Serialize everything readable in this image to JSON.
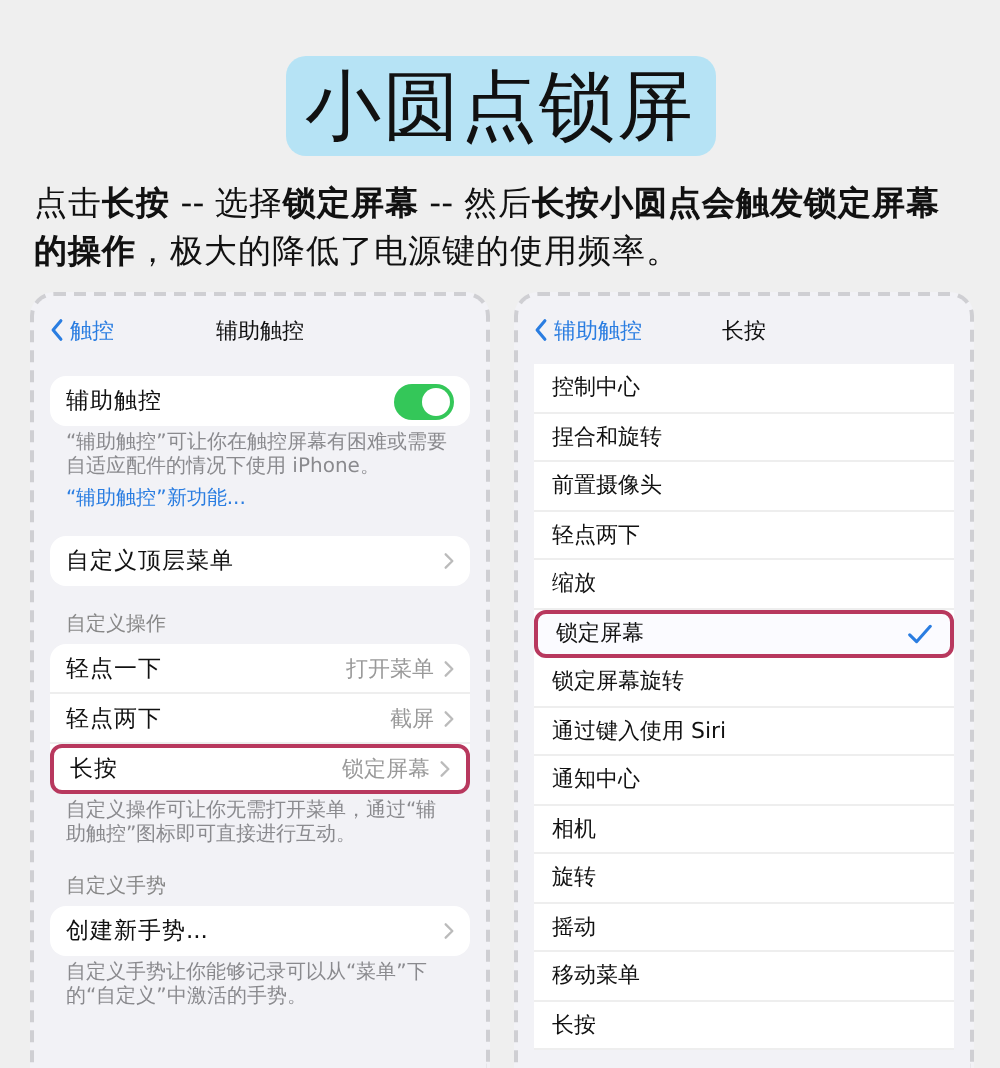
{
  "title": "小圆点锁屏",
  "description": "点击**长按** -- 选择**锁定屏幕** -- 然后**长按小圆点会触发锁定屏幕的操作**，极大的降低了电源键的使用频率。",
  "left_screen": {
    "back": "触控",
    "title": "辅助触控",
    "sections": [
      {
        "rows": [
          {
            "kind": "toggle",
            "label": "辅助触控",
            "on": true
          }
        ],
        "footer": "“辅助触控”可让你在触控屏幕有困难或需要自适应配件的情况下使用 iPhone。",
        "footer_link": "“辅助触控”新功能..."
      },
      {
        "rows": [
          {
            "kind": "link",
            "label": "自定义顶层菜单",
            "highlighted": false
          }
        ]
      },
      {
        "header": "自定义操作",
        "rows": [
          {
            "kind": "link",
            "label": "轻点一下",
            "value": "打开菜单",
            "highlighted": false
          },
          {
            "kind": "link",
            "label": "轻点两下",
            "value": "截屏",
            "highlighted": false
          },
          {
            "kind": "link",
            "label": "长按",
            "value": "锁定屏幕",
            "highlighted": true
          }
        ],
        "footer": "自定义操作可让你无需打开菜单，通过“辅助触控”图标即可直接进行互动。"
      },
      {
        "header": "自定义手势",
        "rows": [
          {
            "kind": "link",
            "label": "创建新手势...",
            "highlighted": false
          }
        ],
        "footer": "自定义手势让你能够记录可以从“菜单”下的“自定义”中激活的手势。"
      }
    ]
  },
  "right_screen": {
    "back": "辅助触控",
    "title": "长按",
    "options": [
      {
        "label": "控制中心",
        "selected": false,
        "highlighted": false
      },
      {
        "label": "捏合和旋转",
        "selected": false,
        "highlighted": false
      },
      {
        "label": "前置摄像头",
        "selected": false,
        "highlighted": false
      },
      {
        "label": "轻点两下",
        "selected": false,
        "highlighted": false
      },
      {
        "label": "缩放",
        "selected": false,
        "highlighted": false
      },
      {
        "label": "锁定屏幕",
        "selected": true,
        "highlighted": true
      },
      {
        "label": "锁定屏幕旋转",
        "selected": false,
        "highlighted": false
      },
      {
        "label": "通过键入使用 Siri",
        "selected": false,
        "highlighted": false
      },
      {
        "label": "通知中心",
        "selected": false,
        "highlighted": false
      },
      {
        "label": "相机",
        "selected": false,
        "highlighted": false
      },
      {
        "label": "旋转",
        "selected": false,
        "highlighted": false
      },
      {
        "label": "摇动",
        "selected": false,
        "highlighted": false
      },
      {
        "label": "移动菜单",
        "selected": false,
        "highlighted": false
      },
      {
        "label": "长按",
        "selected": false,
        "highlighted": false
      }
    ]
  }
}
